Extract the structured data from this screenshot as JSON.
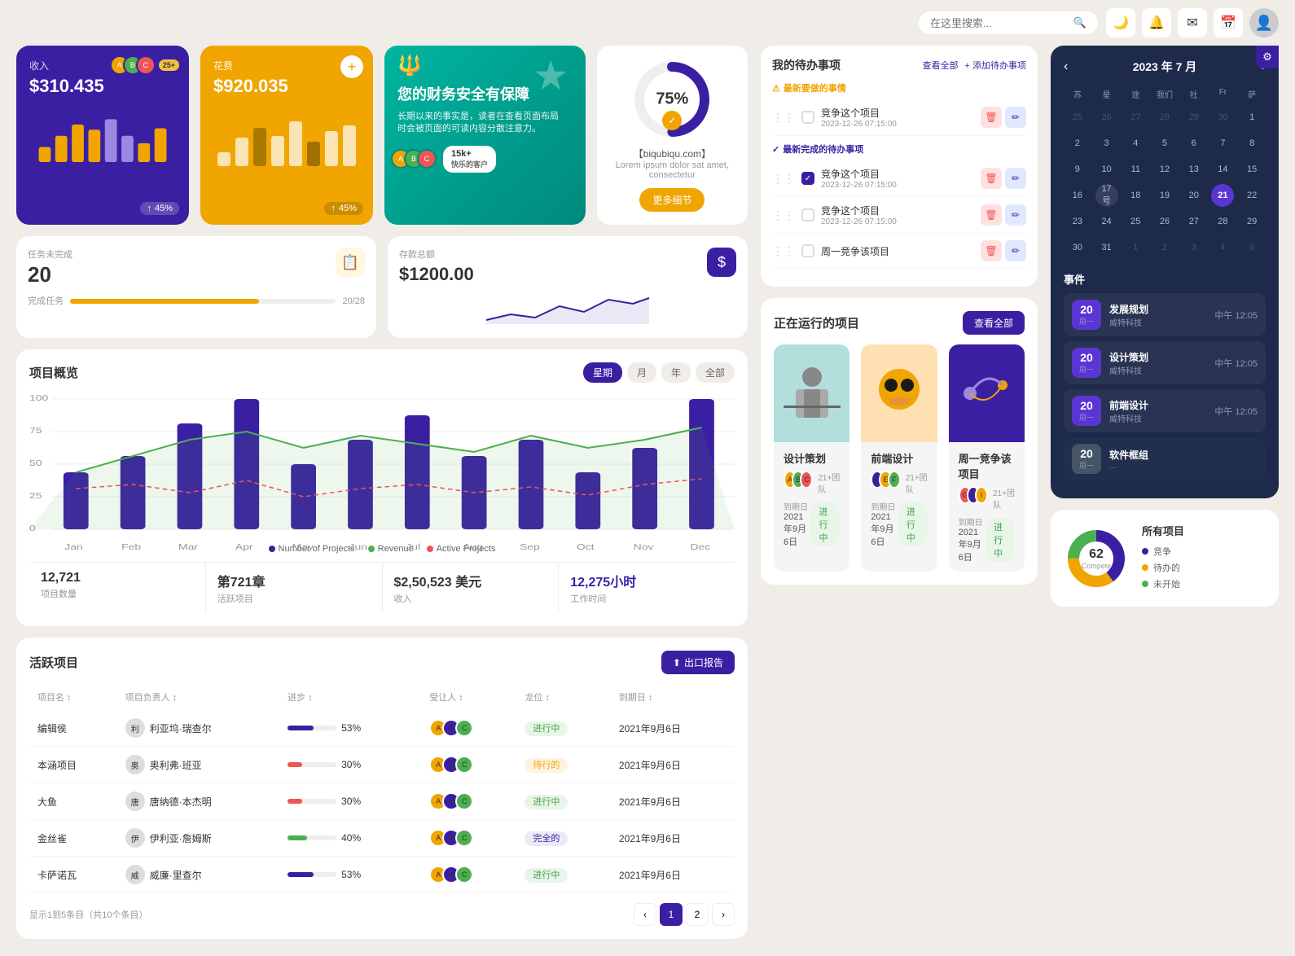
{
  "topbar": {
    "search_placeholder": "在这里搜索...",
    "icons": [
      "🌙",
      "🔔",
      "✉",
      "📅"
    ]
  },
  "revenue_card": {
    "label": "收入",
    "amount": "$310.435",
    "pct": "45%",
    "bars": [
      30,
      50,
      70,
      60,
      80,
      55,
      40,
      65
    ],
    "bar_colors": [
      "#f0a500",
      "#f0a500",
      "#f0a500",
      "#f0a500",
      "#f0a500",
      "#9b88e0",
      "#9b88e0",
      "#f0a500"
    ]
  },
  "expense_card": {
    "label": "花费",
    "amount": "$920.035",
    "pct": "45%",
    "bars": [
      25,
      45,
      60,
      50,
      70,
      40,
      55,
      65
    ],
    "bar_colors": [
      "#fff",
      "#fff",
      "#aaa",
      "#fff",
      "#fff",
      "#555",
      "#fff",
      "#fff"
    ]
  },
  "promo_card": {
    "title": "您的财务安全有保障",
    "desc": "长期以来的事实是，读者在查看页面布局时会被页面的可读内容分散注意力。",
    "customers": "15k+",
    "customers_label": "快乐的客户"
  },
  "donut_card": {
    "pct": "75%",
    "label": "【biqubiqu.com】",
    "sublabel": "Lorem ipsum dolor sat amet, consectetur",
    "btn": "更多细节"
  },
  "task_card": {
    "label": "任务未完成",
    "count": "20",
    "progress_label": "完成任务",
    "progress_text": "20/28",
    "progress_pct": 71
  },
  "savings_card": {
    "label": "存款总额",
    "amount": "$1200.00"
  },
  "chart": {
    "title": "项目概览",
    "tabs": [
      "星期",
      "月",
      "年",
      "全部"
    ],
    "active_tab": 0,
    "months": [
      "Jan",
      "Feb",
      "Mar",
      "Apr",
      "May",
      "Jun",
      "Jul",
      "Aug",
      "Sep",
      "Oct",
      "Nov",
      "Dec"
    ],
    "legend": [
      {
        "label": "Number of Projects",
        "color": "#3b1fa3"
      },
      {
        "label": "Revenue",
        "color": "#4caf50"
      },
      {
        "label": "Active Projects",
        "color": "#e55"
      }
    ],
    "stats": [
      {
        "value": "12,721",
        "label": "项目数量"
      },
      {
        "value": "第721章",
        "label": "活跃项目"
      },
      {
        "value": "$2,50,523 美元",
        "label": "收入"
      },
      {
        "value": "12,275小时",
        "label": "工作时间",
        "accent": true
      }
    ]
  },
  "todo": {
    "title": "我的待办事项",
    "view_all": "查看全部",
    "add": "+ 添加待办事项",
    "urgent_label": "最新要做的事情",
    "done_label": "最新完成的待办事项",
    "items": [
      {
        "text": "竞争这个项目",
        "date": "2023-12-26 07:15:00",
        "done": false,
        "section": "urgent"
      },
      {
        "text": "竞争这个项目",
        "date": "2023-12-26 07:15:00",
        "done": true,
        "section": "done"
      },
      {
        "text": "竞争这个项目",
        "date": "2023-12-26 07:15:00",
        "done": false,
        "section": "other"
      },
      {
        "text": "周一竞争该项目",
        "done": false,
        "section": "other2"
      }
    ]
  },
  "active_projects": {
    "title": "活跃项目",
    "export_btn": "出口报告",
    "columns": [
      "项目名",
      "项目负责人",
      "进步",
      "受让人",
      "龙位",
      "到期日"
    ],
    "rows": [
      {
        "name": "编辑侯",
        "owner": "利亚坞·瑞查尔",
        "progress": 53,
        "bar_color": "#3b1fa3",
        "status": "进行中",
        "status_class": "status-active",
        "due": "2021年9月6日"
      },
      {
        "name": "本涵项目",
        "owner": "奥利弗·班亚",
        "progress": 30,
        "bar_color": "#e55",
        "status": "待行的",
        "status_class": "status-pending",
        "due": "2021年9月6日"
      },
      {
        "name": "大鱼",
        "owner": "唐纳德·本杰明",
        "progress": 30,
        "bar_color": "#e55",
        "status": "进行中",
        "status_class": "status-active",
        "due": "2021年9月6日"
      },
      {
        "name": "金丝雀",
        "owner": "伊利亚·詹姆斯",
        "progress": 40,
        "bar_color": "#4caf50",
        "status": "完全的",
        "status_class": "status-done",
        "due": "2021年9月6日"
      },
      {
        "name": "卡萨诺瓦",
        "owner": "威廉·里查尔",
        "progress": 53,
        "bar_color": "#3b1fa3",
        "status": "进行中",
        "status_class": "status-active",
        "due": "2021年9月6日"
      }
    ],
    "pagination": {
      "info": "显示1到5条目（共10个条目）",
      "pages": [
        1,
        2
      ]
    }
  },
  "running_projects": {
    "title": "正在运行的项目",
    "view_all": "查看全部",
    "cards": [
      {
        "name": "设计策划",
        "team": "21+团队",
        "due_label": "到期日",
        "due": "2021年9月6日",
        "status": "进行中",
        "status_class": "status-active",
        "bg": "#c8e6e0",
        "emoji": "👨‍🏫"
      },
      {
        "name": "前端设计",
        "team": "21+团队",
        "due_label": "到期日",
        "due": "2021年9月6日",
        "status": "进行中",
        "status_class": "status-active",
        "bg": "#ffe0b2",
        "emoji": "🐱"
      },
      {
        "name": "周一竞争该项目",
        "team": "21+团队",
        "due_label": "到期日",
        "due": "2021年9月6日",
        "status": "进行中",
        "status_class": "status-active",
        "bg": "#3b1fa3",
        "emoji": "🌊"
      }
    ]
  },
  "calendar": {
    "title": "2023 年 7 月",
    "day_labels": [
      "苏",
      "星",
      "途",
      "我们",
      "社",
      "Fr",
      "萨"
    ],
    "prev_days": [
      25,
      26,
      27,
      28,
      29,
      30,
      1
    ],
    "days": [
      2,
      3,
      4,
      5,
      6,
      7,
      8,
      9,
      10,
      11,
      12,
      13,
      14,
      15,
      16,
      "17号",
      18,
      19,
      20,
      21,
      22,
      23,
      24,
      25,
      26,
      27,
      28,
      29,
      30,
      31
    ],
    "next_days": [
      1,
      2,
      3,
      4,
      5
    ],
    "today": 21,
    "events_title": "事件",
    "events": [
      {
        "day": "20",
        "weekday": "周一",
        "name": "发展规划",
        "company": "威特科技",
        "time": "中午 12:05",
        "color": "#5b35d4"
      },
      {
        "day": "20",
        "weekday": "周一",
        "name": "设计策划",
        "company": "威特科技",
        "time": "中午 12:05",
        "color": "#5b35d4"
      },
      {
        "day": "20",
        "weekday": "周一",
        "name": "前端设计",
        "company": "威特科技",
        "time": "中午 12:05",
        "color": "#5b35d4"
      },
      {
        "day": "20",
        "weekday": "周一",
        "name": "软件框组",
        "company": "...",
        "time": "",
        "color": "#445566"
      }
    ]
  },
  "pie_chart": {
    "title": "所有项目",
    "total": "62",
    "total_label": "Compete",
    "segments": [
      {
        "label": "竞争",
        "color": "#3b1fa3",
        "pct": 40
      },
      {
        "label": "待办的",
        "color": "#f0a500",
        "pct": 35
      },
      {
        "label": "未开始",
        "color": "#4caf50",
        "pct": 25
      }
    ]
  }
}
